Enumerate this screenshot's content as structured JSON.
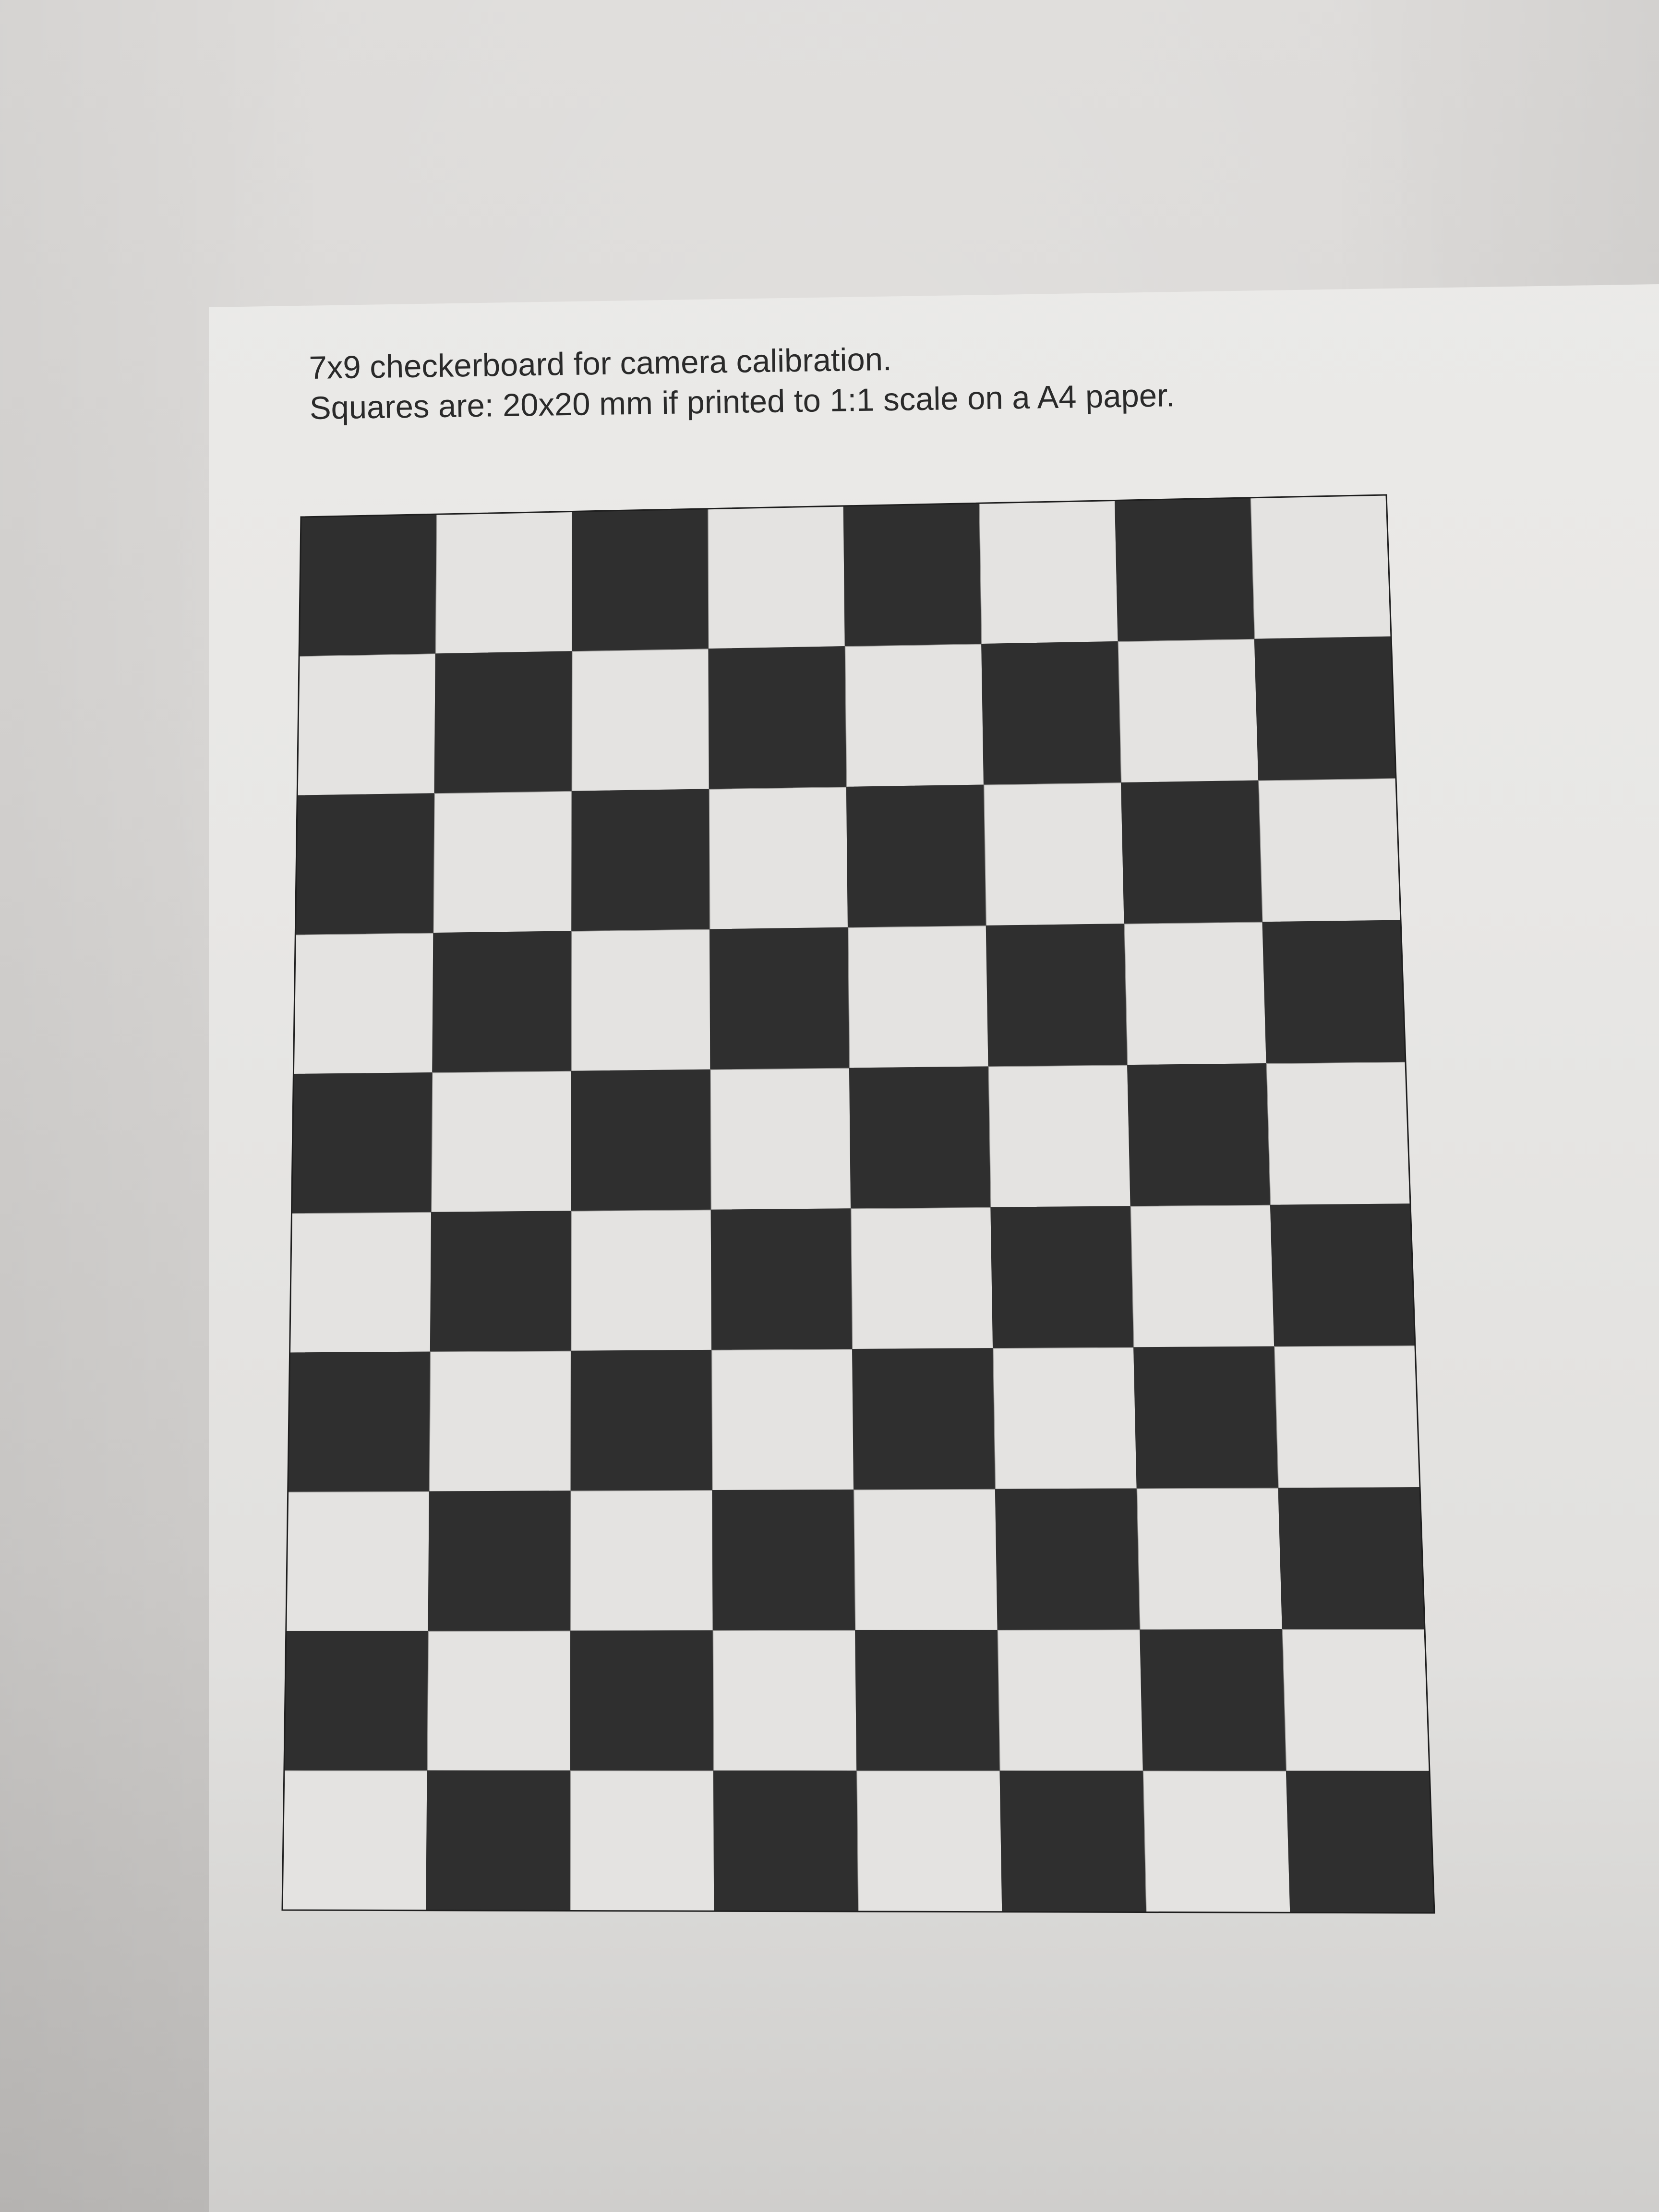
{
  "caption": {
    "line1": "7x9 checkerboard for camera calibration.",
    "line2": "Squares are: 20x20 mm if printed to 1:1 scale on a A4 paper."
  },
  "board": {
    "columns": 8,
    "rows": 10,
    "top_left_color": "dark",
    "dark_color": "#2f2f2f",
    "light_color": "#e4e3e1",
    "border_color": "#1e1e1e"
  },
  "colors": {
    "desk": "#d9d7d5",
    "paper": "#e8e7e5",
    "text": "#2a2a2a"
  }
}
